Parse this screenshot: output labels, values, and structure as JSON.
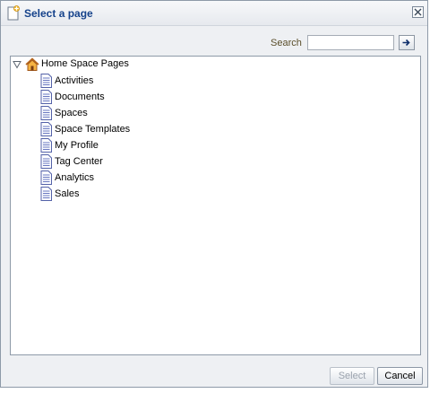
{
  "dialog": {
    "title": "Select a page",
    "title_icon": "new-page-icon",
    "close_icon": "close-icon"
  },
  "search": {
    "label": "Search",
    "value": "",
    "placeholder": "",
    "go_icon": "arrow-right-icon"
  },
  "tree": {
    "root": {
      "label": "Home Space Pages",
      "icon": "home-icon",
      "expanded": true
    },
    "items": [
      {
        "label": "Activities",
        "icon": "page-icon"
      },
      {
        "label": "Documents",
        "icon": "page-icon"
      },
      {
        "label": "Spaces",
        "icon": "page-icon"
      },
      {
        "label": "Space Templates",
        "icon": "page-icon"
      },
      {
        "label": "My Profile",
        "icon": "page-icon"
      },
      {
        "label": "Tag Center",
        "icon": "page-icon"
      },
      {
        "label": "Analytics",
        "icon": "page-icon"
      },
      {
        "label": "Sales",
        "icon": "page-icon"
      }
    ]
  },
  "buttons": {
    "select_label": "Select",
    "select_enabled": false,
    "cancel_label": "Cancel"
  }
}
